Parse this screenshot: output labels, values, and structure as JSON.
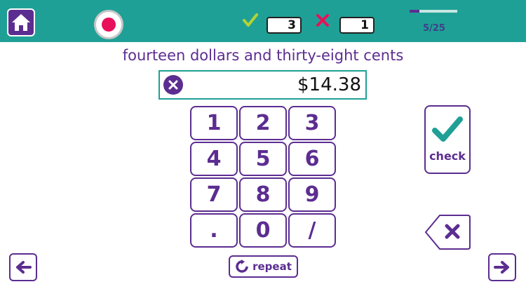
{
  "score": {
    "correct": "3",
    "wrong": "1"
  },
  "progress": {
    "label": "5/25",
    "fraction": 0.2
  },
  "prompt": "fourteen dollars and thirty-eight cents",
  "answer": "$14.38",
  "keypad": [
    "1",
    "2",
    "3",
    "4",
    "5",
    "6",
    "7",
    "8",
    "9",
    ".",
    "0",
    "/"
  ],
  "check_label": "check",
  "repeat_label": "repeat",
  "icons": {
    "home": "home-icon",
    "record": "record-icon",
    "correct": "checkmark-icon",
    "wrong": "cross-icon",
    "clear": "clear-icon",
    "backspace": "backspace-icon",
    "repeat": "repeat-icon",
    "prev": "arrow-left-icon",
    "next": "arrow-right-icon"
  },
  "colors": {
    "teal": "#1fa096",
    "purple": "#5c2d91",
    "record": "#e8105a",
    "correct": "#b4d334",
    "wrong": "#e8105a"
  }
}
